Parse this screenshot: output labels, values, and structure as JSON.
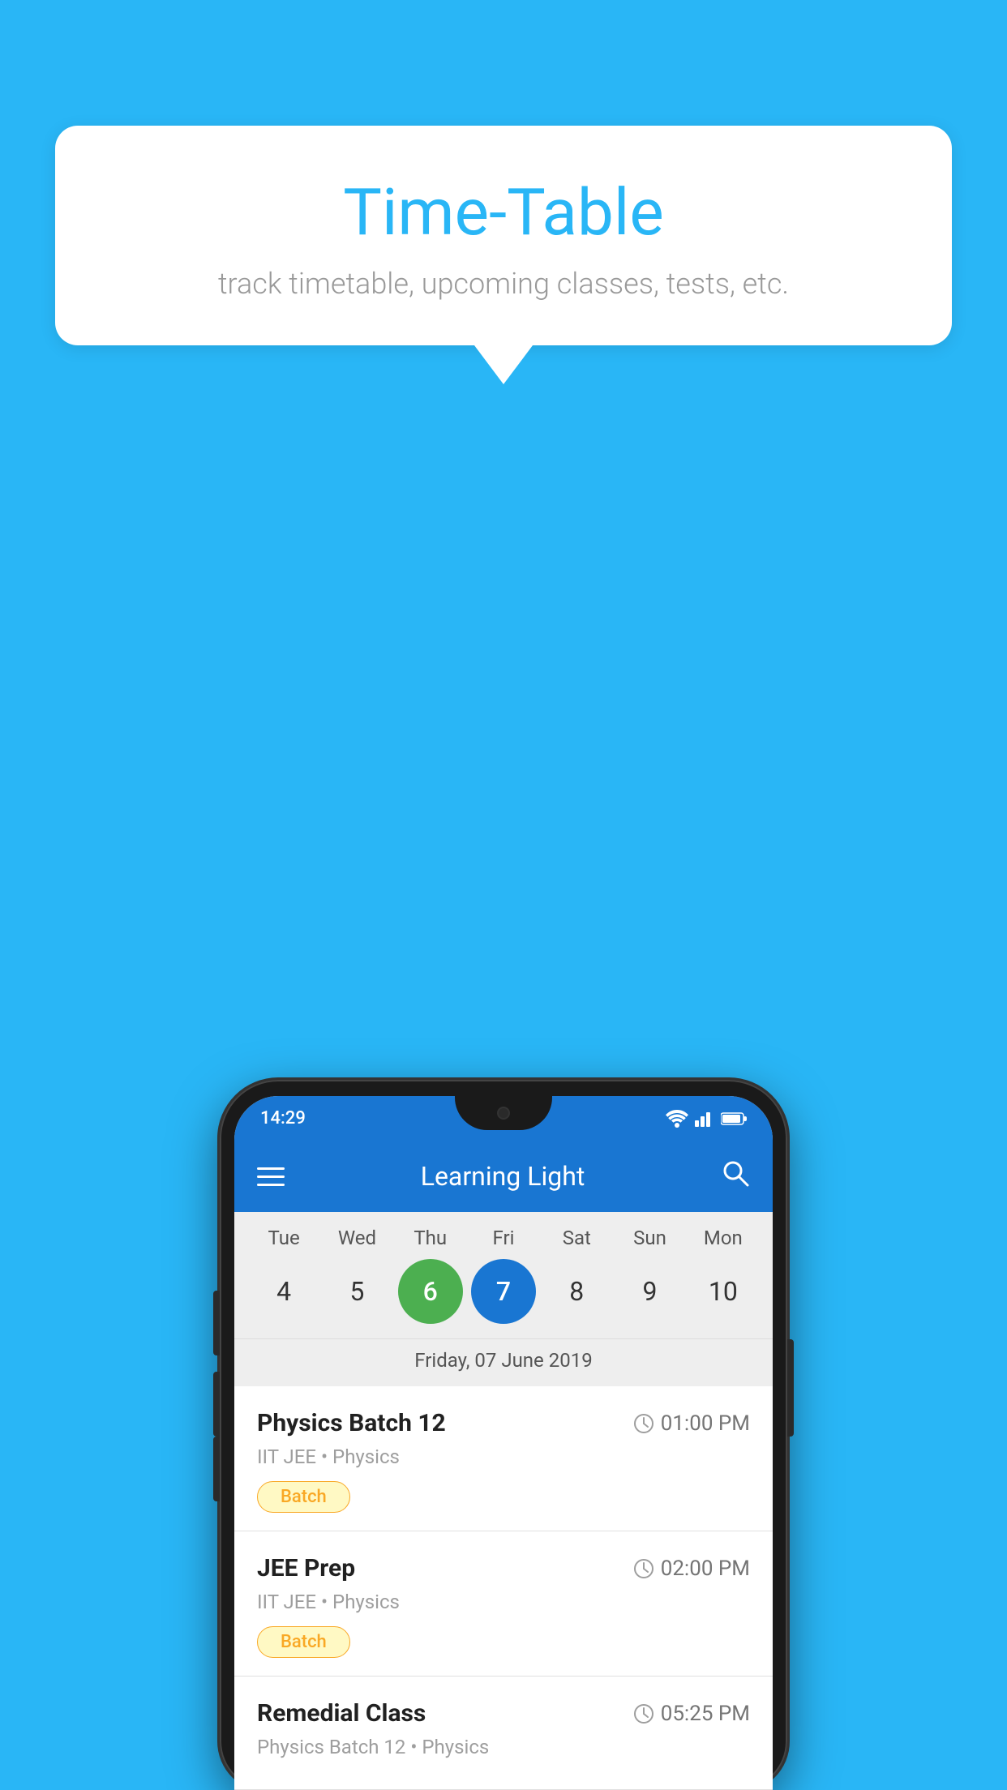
{
  "page": {
    "background_color": "#29B6F6"
  },
  "speech_bubble": {
    "title": "Time-Table",
    "subtitle": "track timetable, upcoming classes, tests, etc."
  },
  "app": {
    "title": "Learning Light",
    "status_bar": {
      "time": "14:29"
    }
  },
  "calendar": {
    "days": [
      {
        "label": "Tue",
        "num": "4",
        "state": "normal"
      },
      {
        "label": "Wed",
        "num": "5",
        "state": "normal"
      },
      {
        "label": "Thu",
        "num": "6",
        "state": "today"
      },
      {
        "label": "Fri",
        "num": "7",
        "state": "selected"
      },
      {
        "label": "Sat",
        "num": "8",
        "state": "normal"
      },
      {
        "label": "Sun",
        "num": "9",
        "state": "normal"
      },
      {
        "label": "Mon",
        "num": "10",
        "state": "normal"
      }
    ],
    "selected_date_label": "Friday, 07 June 2019"
  },
  "schedule": {
    "items": [
      {
        "title": "Physics Batch 12",
        "time": "01:00 PM",
        "subtitle": "IIT JEE • Physics",
        "badge": "Batch"
      },
      {
        "title": "JEE Prep",
        "time": "02:00 PM",
        "subtitle": "IIT JEE • Physics",
        "badge": "Batch"
      },
      {
        "title": "Remedial Class",
        "time": "05:25 PM",
        "subtitle": "Physics Batch 12 • Physics",
        "badge": null
      }
    ]
  },
  "icons": {
    "hamburger": "≡",
    "search": "🔍",
    "clock": "🕐"
  }
}
